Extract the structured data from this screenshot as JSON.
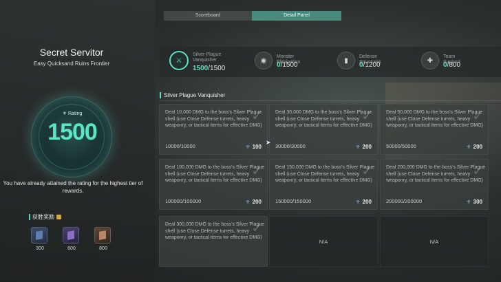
{
  "tabs": [
    {
      "label": "Scoreboard",
      "active": false
    },
    {
      "label": "Detail Panel",
      "active": true
    }
  ],
  "left_panel": {
    "title": "Secret Servitor",
    "subtitle": "Easy Quicksand Ruins Frontier",
    "rating_label": "Rating",
    "rating_value": "1500",
    "notice": "You have already attained the rating for the highest tier of rewards.",
    "rewards_title": "获胜奖励",
    "rewards": [
      {
        "value": "300",
        "color": "#5e7fb0"
      },
      {
        "value": "600",
        "color": "#8a6fc4"
      },
      {
        "value": "800",
        "color": "#b8846a"
      }
    ]
  },
  "stats": [
    {
      "label": "Silver Plague Vanquisher",
      "current": "1500",
      "total": "/1500",
      "icon": "silver-plague-icon",
      "active": true
    },
    {
      "label": "Monster Elimination",
      "current": "0",
      "total": "/1500",
      "icon": "monster-eye-icon",
      "active": false
    },
    {
      "label": "Defense Structures",
      "current": "0",
      "total": "/1200",
      "icon": "defense-tower-icon",
      "active": false
    },
    {
      "label": "Team Support",
      "current": "0",
      "total": "/800",
      "icon": "support-icon",
      "active": false
    }
  ],
  "section_title": "Silver Plague Vanquisher",
  "tasks": [
    {
      "desc": "Deal 10,000 DMG to the boss's Silver Plague shell (use Close Defense turrets, heavy weaponry, or tactical items for effective DMG)",
      "progress": "10000/10000",
      "reward": "100",
      "done": true
    },
    {
      "desc": "Deal 30,000 DMG to the boss's Silver Plague shell (use Close Defense turrets, heavy weaponry, or tactical items for effective DMG)",
      "progress": "30000/30000",
      "reward": "200",
      "done": true
    },
    {
      "desc": "Deal 50,000 DMG to the boss's Silver Plague shell (use Close Defense turrets, heavy weaponry, or tactical items for effective DMG)",
      "progress": "50000/50000",
      "reward": "200",
      "done": true
    },
    {
      "desc": "Deal 100,000 DMG to the boss's Silver Plague shell (use Close Defense turrets, heavy weaponry, or tactical items for effective DMG)",
      "progress": "100000/100000",
      "reward": "200",
      "done": true
    },
    {
      "desc": "Deal 150,000 DMG to the boss's Silver Plague shell (use Close Defense turrets, heavy weaponry, or tactical items for effective DMG)",
      "progress": "150000/150000",
      "reward": "200",
      "done": true
    },
    {
      "desc": "Deal 200,000 DMG to the boss's Silver Plague shell (use Close Defense turrets, heavy weaponry, or tactical items for effective DMG)",
      "progress": "200000/200000",
      "reward": "300",
      "done": true
    },
    {
      "desc": "Deal 300,000 DMG to the boss's Silver Plague shell (use Close Defense turrets, heavy weaponry, or tactical items for effective DMG)",
      "progress": "",
      "reward": "",
      "done": true
    },
    {
      "na": "N/A"
    },
    {
      "na": "N/A"
    }
  ],
  "colors": {
    "accent": "#5fe0c0",
    "tab_active": "#4a8a7c"
  }
}
